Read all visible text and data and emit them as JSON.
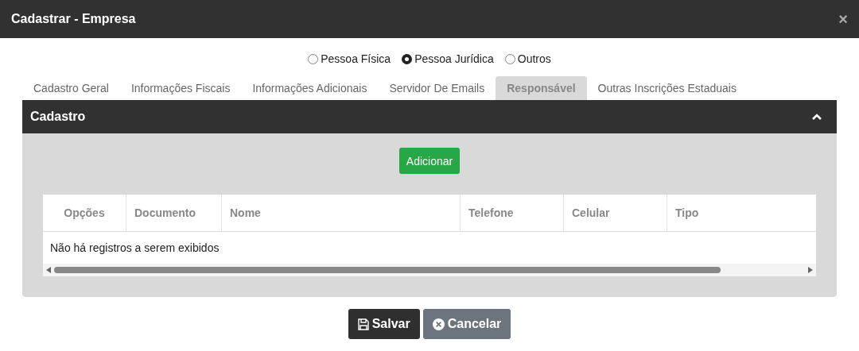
{
  "window": {
    "title": "Cadastrar - Empresa",
    "close": "×"
  },
  "person_type": [
    {
      "label": "Pessoa Física",
      "selected": false
    },
    {
      "label": "Pessoa Jurídica",
      "selected": true
    },
    {
      "label": "Outros",
      "selected": false
    }
  ],
  "tabs": [
    {
      "label": "Cadastro Geral",
      "selected": false
    },
    {
      "label": "Informações Fiscais",
      "selected": false
    },
    {
      "label": "Informações Adicionais",
      "selected": false
    },
    {
      "label": "Servidor De Emails",
      "selected": false
    },
    {
      "label": "Responsável",
      "selected": true
    },
    {
      "label": "Outras Inscrições Estaduais",
      "selected": false
    }
  ],
  "panel": {
    "title": "Cadastro",
    "expanded": true,
    "add_button": "Adicionar",
    "table": {
      "columns": [
        "Opções",
        "Documento",
        "Nome",
        "Telefone",
        "Celular",
        "Tipo"
      ],
      "empty_message": "Não há registros a serem exibidos"
    }
  },
  "buttons": [
    {
      "kind": "save",
      "label": "Salvar"
    },
    {
      "kind": "cancel",
      "label": "Cancelar"
    }
  ]
}
